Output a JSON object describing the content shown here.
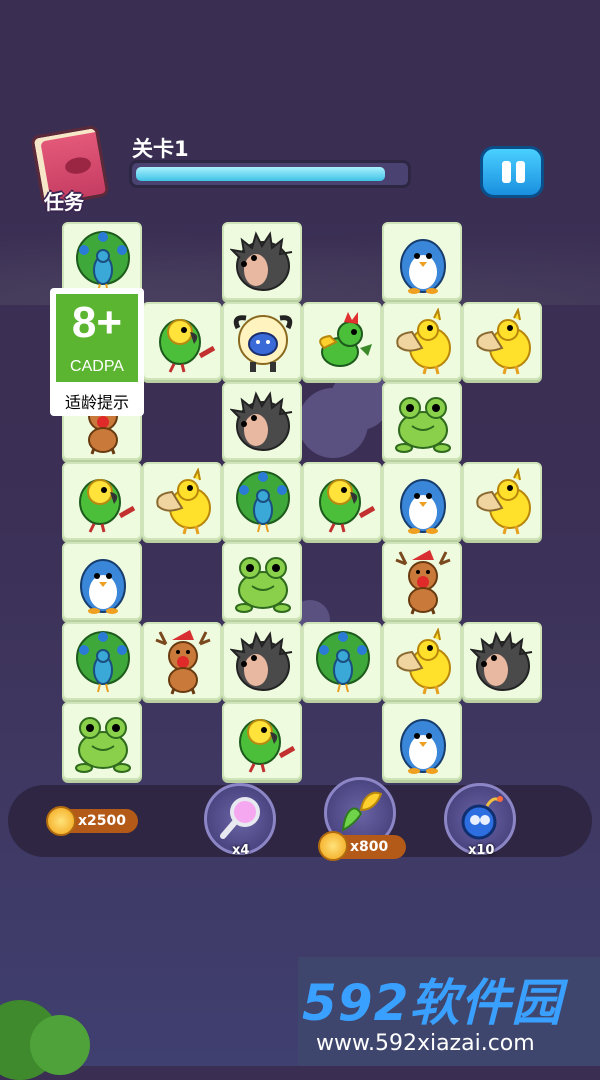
{
  "hud": {
    "task_label": "任务",
    "level_label": "关卡1",
    "progress": 0.93
  },
  "rating": {
    "age": "8+",
    "org": "CADPA",
    "note": "适龄提示"
  },
  "board": {
    "tiles": [
      {
        "animal": "peacock",
        "row": 0,
        "col": 0
      },
      {
        "animal": "hedgehog",
        "row": 0,
        "col": 2
      },
      {
        "animal": "penguin",
        "row": 0,
        "col": 4
      },
      {
        "animal": "parrot",
        "row": 1,
        "col": 1
      },
      {
        "animal": "sheep",
        "row": 1,
        "col": 2
      },
      {
        "animal": "rooster",
        "row": 1,
        "col": 3
      },
      {
        "animal": "pelican",
        "row": 1,
        "col": 4
      },
      {
        "animal": "pelican",
        "row": 1,
        "col": 5
      },
      {
        "animal": "deer",
        "row": 2,
        "col": 0
      },
      {
        "animal": "hedgehog",
        "row": 2,
        "col": 2
      },
      {
        "animal": "frog",
        "row": 2,
        "col": 4
      },
      {
        "animal": "parrot",
        "row": 3,
        "col": 0
      },
      {
        "animal": "pelican",
        "row": 3,
        "col": 1
      },
      {
        "animal": "peacock",
        "row": 3,
        "col": 2
      },
      {
        "animal": "parrot",
        "row": 3,
        "col": 3
      },
      {
        "animal": "penguin",
        "row": 3,
        "col": 4
      },
      {
        "animal": "pelican",
        "row": 3,
        "col": 5
      },
      {
        "animal": "penguin",
        "row": 4,
        "col": 0
      },
      {
        "animal": "frog",
        "row": 4,
        "col": 2
      },
      {
        "animal": "deer",
        "row": 4,
        "col": 4
      },
      {
        "animal": "peacock",
        "row": 5,
        "col": 0
      },
      {
        "animal": "deer",
        "row": 5,
        "col": 1
      },
      {
        "animal": "hedgehog",
        "row": 5,
        "col": 2
      },
      {
        "animal": "peacock",
        "row": 5,
        "col": 3
      },
      {
        "animal": "pelican",
        "row": 5,
        "col": 4
      },
      {
        "animal": "hedgehog",
        "row": 5,
        "col": 5
      },
      {
        "animal": "frog",
        "row": 6,
        "col": 0
      },
      {
        "animal": "parrot",
        "row": 6,
        "col": 2
      },
      {
        "animal": "penguin",
        "row": 6,
        "col": 4
      }
    ]
  },
  "toolbar": {
    "coins": "x2500",
    "hint_count": "x4",
    "shuffle_cost": "x800",
    "bomb_count": "x10"
  },
  "watermark": {
    "brand": "592软件园",
    "url": "www.592xiazai.com"
  },
  "colors": {
    "background": "#3b2f55",
    "tile": "#eefbdf",
    "progress_fill": "#3fc2e6",
    "pause_button": "#1a8fdf",
    "cadpa_green": "#5cb531"
  }
}
